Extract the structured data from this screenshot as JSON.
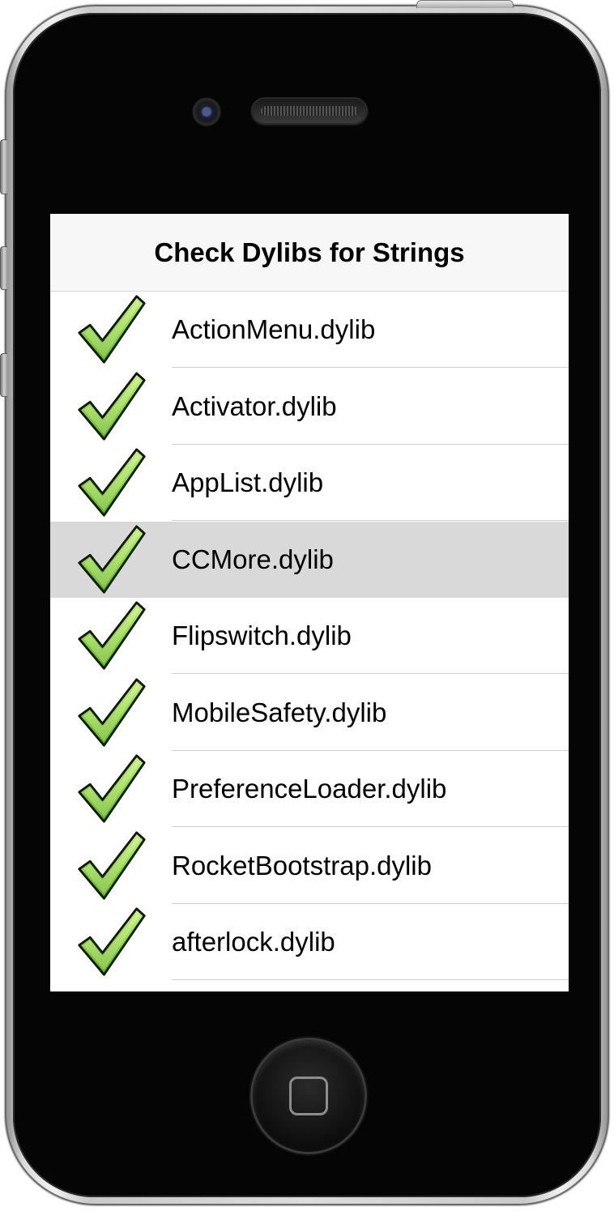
{
  "navigation": {
    "title": "Check Dylibs for Strings"
  },
  "dylibs": [
    {
      "label": "ActionMenu.dylib",
      "checked": true,
      "selected": false
    },
    {
      "label": "Activator.dylib",
      "checked": true,
      "selected": false
    },
    {
      "label": "AppList.dylib",
      "checked": true,
      "selected": false
    },
    {
      "label": "CCMore.dylib",
      "checked": true,
      "selected": true
    },
    {
      "label": "Flipswitch.dylib",
      "checked": true,
      "selected": false
    },
    {
      "label": "MobileSafety.dylib",
      "checked": true,
      "selected": false
    },
    {
      "label": "PreferenceLoader.dylib",
      "checked": true,
      "selected": false
    },
    {
      "label": "RocketBootstrap.dylib",
      "checked": true,
      "selected": false
    },
    {
      "label": "afterlock.dylib",
      "checked": true,
      "selected": false
    }
  ],
  "icons": {
    "checkmark": "green-checkmark-icon"
  },
  "colors": {
    "check_fill": "#7ed321",
    "selected_row": "#d9d9d9",
    "nav_bg": "#f7f7f7"
  }
}
